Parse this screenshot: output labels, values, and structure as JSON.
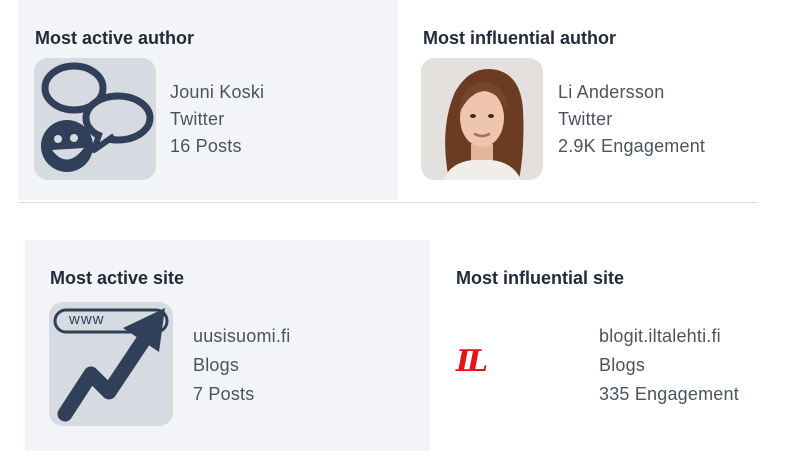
{
  "cards": {
    "active_author": {
      "title": "Most active author",
      "name": "Jouni Koski",
      "platform": "Twitter",
      "metric": "16 Posts",
      "icon": "chat-bubbles-icon"
    },
    "influential_author": {
      "title": "Most influential author",
      "name": "Li Andersson",
      "platform": "Twitter",
      "metric": "2.9K Engagement"
    },
    "active_site": {
      "title": "Most active site",
      "name": "uusisuomi.fi",
      "platform": "Blogs",
      "metric": "7 Posts",
      "icon": "www-trend-up-icon",
      "icon_label": "www"
    },
    "influential_site": {
      "title": "Most influential site",
      "name": "blogit.iltalehti.fi",
      "platform": "Blogs",
      "metric": "335 Engagement",
      "logo_text": "IL"
    }
  },
  "colors": {
    "card_bg": "#f2f4f7",
    "icon_fill": "#2f4058",
    "avatar_bg": "#d6dbe2",
    "logo_red": "#e8111a"
  }
}
